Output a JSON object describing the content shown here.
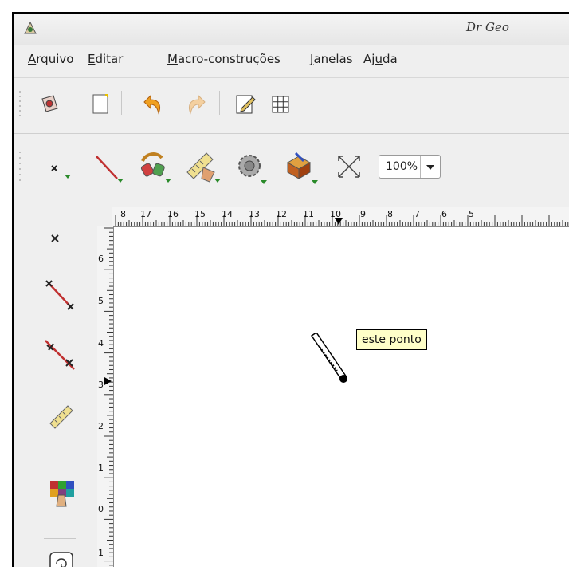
{
  "window": {
    "title": "Dr Geo",
    "menu": [
      {
        "mnemonic": "A",
        "rest": "rquivo"
      },
      {
        "mnemonic": "E",
        "rest": "ditar"
      },
      {
        "mnemonic": "M",
        "rest": "acro-construções"
      },
      {
        "mnemonic": "J",
        "rest": "anelas"
      },
      {
        "pre": "Aj",
        "mnemonic": "u",
        "rest": "da"
      }
    ]
  },
  "toolbar2": {
    "zoom_value": "100%"
  },
  "rulers": {
    "horizontal": [
      "8",
      "17",
      "16",
      "15",
      "14",
      "13",
      "12",
      "11",
      "10",
      "9",
      "8",
      "7",
      "6",
      "5"
    ],
    "vertical": [
      "6",
      "5",
      "4",
      "3",
      "2",
      "1",
      "0",
      "1"
    ]
  },
  "canvas": {
    "tooltip": "este ponto"
  },
  "colors": {
    "accent_green": "#2a8a2a",
    "tooltip_bg": "#ffffc8",
    "ruler_bg": "#f4f4f4"
  }
}
